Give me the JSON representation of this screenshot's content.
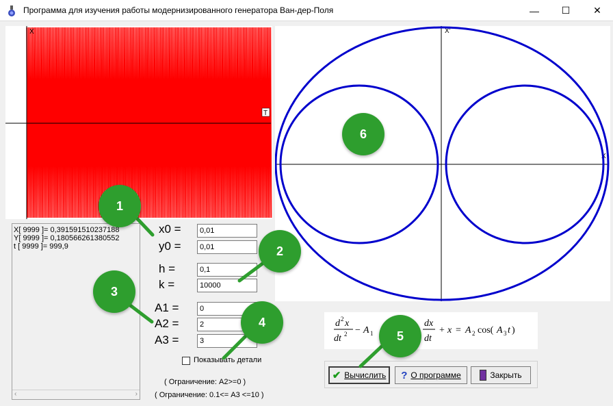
{
  "window": {
    "title": "Программа для изучения работы модернизированного генератора Ван-дер-Поля",
    "minimize_glyph": "—",
    "maximize_glyph": "☐",
    "close_glyph": "✕"
  },
  "time_plot": {
    "axis_y_label": "X",
    "axis_x_label": "T",
    "signal_color": "#ff0000"
  },
  "phase_plot": {
    "axis_y_label": "X'",
    "axis_x_label": "X",
    "curve_color": "#0000cc"
  },
  "log": {
    "lines": [
      "X[ 9999 ]= 0,391591510237188",
      "Y[ 9999 ]= 0,180566261380552",
      "t  [ 9999 ]= 999,9"
    ]
  },
  "params": {
    "x0": {
      "label": "x0 =",
      "value": "0,01"
    },
    "y0": {
      "label": "y0 =",
      "value": "0,01"
    },
    "h": {
      "label": "h =",
      "value": "0,1"
    },
    "k": {
      "label": "k =",
      "value": "10000"
    },
    "A1": {
      "label": "A1 =",
      "value": "0"
    },
    "A2": {
      "label": "A2 =",
      "value": "2"
    },
    "A3": {
      "label": "A3 =",
      "value": "3"
    }
  },
  "details_checkbox": {
    "label": "Показывать детали",
    "checked": false
  },
  "constraints": {
    "a2": "( Ограничение:  A2>=0 )",
    "a3": "( Ограничение:  0.1<= A3 <=10 )"
  },
  "buttons": {
    "calculate": "Вычислить",
    "about": "О программе",
    "close": "Закрыть"
  },
  "badges": [
    "1",
    "2",
    "3",
    "4",
    "5",
    "6"
  ],
  "accent_colors": {
    "badge": "#2e9e2e",
    "plot_signal": "#ff0000",
    "plot_curve": "#0000cc"
  }
}
